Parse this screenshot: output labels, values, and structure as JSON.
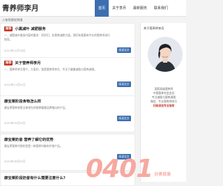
{
  "header": {
    "logo": "青养师李月",
    "subtitle": "人依然感觉到饿",
    "nav": [
      {
        "label": "首页",
        "active": true
      },
      {
        "label": "关于李月"
      },
      {
        "label": "最新服务"
      },
      {
        "label": "联系我们"
      }
    ]
  },
  "posts": [
    {
      "tag": "推荐",
      "title": "小黑减叶 减肥服务",
      "excerpt": "一、减肥减叶服务内容的要求：同学们，在营养减肥方面，我们有需要有专业的营养师进行指导。",
      "date": "2021年10月18日",
      "more": "阅读全文"
    },
    {
      "tag": "推荐",
      "title": "关于营养师李月",
      "excerpt": "一、营养师李月简介，大家好，我是营养师李月，专注于健康减脂与营养调理。",
      "date": "2021年11月01日",
      "more": "阅读全文"
    },
    {
      "title": "康宝莱阶段食物怎么样",
      "excerpt": "康宝莱营养餐是全球领先的营养健康品牌推出的产品。",
      "date": "2022年05月25日",
      "more": "阅读全文"
    },
    {
      "title": "康宝莱奶昔 营养了解它的优势",
      "excerpt": "康宝莱营养代餐奶昔是一款营养均衡的代餐产品。",
      "date": "2022年06月05日",
      "more": "阅读全文"
    },
    {
      "title": "康宝莱阶段奶昔有什么需要注意什么?",
      "excerpt": "",
      "date": "",
      "more": ""
    }
  ],
  "sidebar": {
    "title": "关于营养师李月",
    "lines": [
      "国家高级营养师",
      "中国营养学会会员",
      "专注减脂与营养调理",
      "微信：专业营养师李月"
    ],
    "highlight": "扫码添加专业指导"
  },
  "watermark": {
    "number": "0401",
    "line1": "分类目录"
  },
  "colors": {
    "accent": "#3d6fb0",
    "tag": "#c0392b",
    "watermark": "#f6a9a0"
  }
}
